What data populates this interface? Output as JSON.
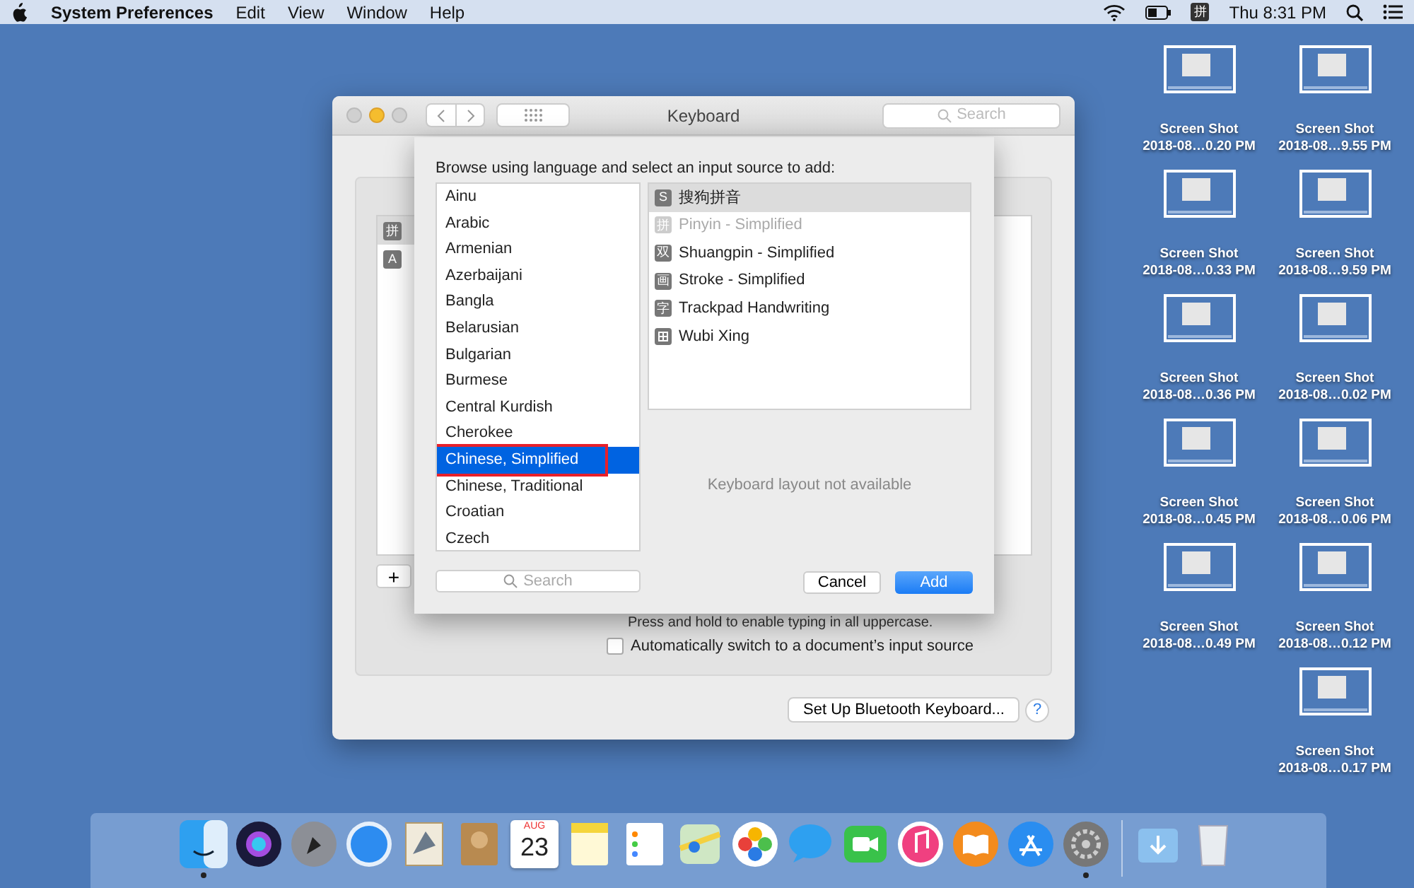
{
  "menu_bar": {
    "menus": [
      {
        "label": "System Preferences",
        "kind": "app"
      },
      {
        "label": "Edit",
        "kind": "menu"
      },
      {
        "label": "View",
        "kind": "menu"
      },
      {
        "label": "Window",
        "kind": "menu"
      },
      {
        "label": "Help",
        "kind": "menu"
      }
    ],
    "input_icon": "拼",
    "clock": "Thu 8:31 PM"
  },
  "window": {
    "title": "Keyboard",
    "search_placeholder": "Search",
    "input_sources": [
      {
        "icon": "拼",
        "selected": true
      },
      {
        "icon": "A",
        "selected": false
      }
    ],
    "add_button": "+",
    "caps_hint": "Press and hold to enable typing in all uppercase.",
    "auto_switch": {
      "label": "Automatically switch to a document’s input source",
      "checked": false
    },
    "bluetooth_button": "Set Up Bluetooth Keyboard...",
    "help_button": "?"
  },
  "sheet": {
    "prompt": "Browse using language and select an input source to add:",
    "languages": [
      {
        "label": "Ainu",
        "selected": false,
        "annotated": false
      },
      {
        "label": "Arabic",
        "selected": false,
        "annotated": false
      },
      {
        "label": "Armenian",
        "selected": false,
        "annotated": false
      },
      {
        "label": "Azerbaijani",
        "selected": false,
        "annotated": false
      },
      {
        "label": "Bangla",
        "selected": false,
        "annotated": false
      },
      {
        "label": "Belarusian",
        "selected": false,
        "annotated": false
      },
      {
        "label": "Bulgarian",
        "selected": false,
        "annotated": false
      },
      {
        "label": "Burmese",
        "selected": false,
        "annotated": false
      },
      {
        "label": "Central Kurdish",
        "selected": false,
        "annotated": false
      },
      {
        "label": "Cherokee",
        "selected": false,
        "annotated": false
      },
      {
        "label": "Chinese, Simplified",
        "selected": true,
        "annotated": true
      },
      {
        "label": "Chinese, Traditional",
        "selected": false,
        "annotated": false
      },
      {
        "label": "Croatian",
        "selected": false,
        "annotated": false
      },
      {
        "label": "Czech",
        "selected": false,
        "annotated": false
      }
    ],
    "input_methods": [
      {
        "label": "搜狗拼音",
        "glyph": "S",
        "selected": true,
        "disabled": false
      },
      {
        "label": "Pinyin - Simplified",
        "glyph": "拼",
        "selected": false,
        "disabled": true
      },
      {
        "label": "Shuangpin - Simplified",
        "glyph": "双",
        "selected": false,
        "disabled": false
      },
      {
        "label": "Stroke - Simplified",
        "glyph": "画",
        "selected": false,
        "disabled": false
      },
      {
        "label": "Trackpad Handwriting",
        "glyph": "字",
        "selected": false,
        "disabled": false
      },
      {
        "label": "Wubi Xing",
        "selected": false,
        "disabled": false
      }
    ],
    "preview_note": "Keyboard layout not available",
    "search_placeholder": "Search",
    "cancel_button": "Cancel",
    "add_button": "Add"
  },
  "desktop_columns": [
    [
      {
        "title": "Screen Shot",
        "subtitle": "2018-08…0.20 PM"
      },
      {
        "title": "Screen Shot",
        "subtitle": "2018-08…0.33 PM"
      },
      {
        "title": "Screen Shot",
        "subtitle": "2018-08…0.36 PM"
      },
      {
        "title": "Screen Shot",
        "subtitle": "2018-08…0.45 PM"
      },
      {
        "title": "Screen Shot",
        "subtitle": "2018-08…0.49 PM"
      }
    ],
    [
      {
        "title": "Screen Shot",
        "subtitle": "2018-08…9.55 PM"
      },
      {
        "title": "Screen Shot",
        "subtitle": "2018-08…9.59 PM"
      },
      {
        "title": "Screen Shot",
        "subtitle": "2018-08…0.02 PM"
      },
      {
        "title": "Screen Shot",
        "subtitle": "2018-08…0.06 PM"
      },
      {
        "title": "Screen Shot",
        "subtitle": "2018-08…0.12 PM"
      },
      {
        "title": "Screen Shot",
        "subtitle": "2018-08…0.17 PM"
      }
    ]
  ],
  "dock": [
    {
      "kind": "finder",
      "running": true
    },
    {
      "kind": "siri",
      "running": false
    },
    {
      "kind": "launchpad",
      "running": false
    },
    {
      "kind": "safari",
      "running": false
    },
    {
      "kind": "mail",
      "running": false
    },
    {
      "kind": "contacts",
      "running": false
    },
    {
      "kind": "calendar",
      "running": false,
      "month": "AUG",
      "day": "23"
    },
    {
      "kind": "notes",
      "running": false
    },
    {
      "kind": "reminders",
      "running": false
    },
    {
      "kind": "maps",
      "running": false
    },
    {
      "kind": "photos",
      "running": false
    },
    {
      "kind": "messages",
      "running": false
    },
    {
      "kind": "facetime",
      "running": false
    },
    {
      "kind": "music",
      "running": false
    },
    {
      "kind": "books",
      "running": false
    },
    {
      "kind": "appstore",
      "running": false
    },
    {
      "kind": "settings",
      "running": true
    },
    {
      "kind": "separator"
    },
    {
      "kind": "downloads",
      "running": false
    },
    {
      "kind": "trash",
      "running": false
    }
  ]
}
